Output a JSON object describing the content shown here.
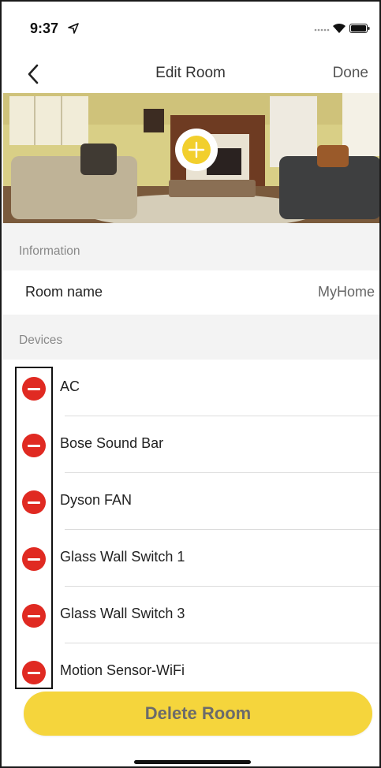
{
  "status_bar": {
    "time": "9:37"
  },
  "nav": {
    "back_icon": "chevron-left-icon",
    "title": "Edit Room",
    "done_label": "Done"
  },
  "photo": {
    "add_icon": "plus-icon"
  },
  "information": {
    "header": "Information",
    "room_name_label": "Room name",
    "room_name_value": "MyHome"
  },
  "devices": {
    "header": "Devices",
    "items": [
      {
        "name": "AC"
      },
      {
        "name": "Bose Sound Bar"
      },
      {
        "name": "Dyson FAN"
      },
      {
        "name": "Glass Wall Switch 1"
      },
      {
        "name": "Glass Wall Switch 3"
      },
      {
        "name": "Motion Sensor-WiFi"
      }
    ]
  },
  "delete_room_label": "Delete Room",
  "colors": {
    "accent_yellow": "#f5d53c",
    "remove_red": "#e02a22"
  }
}
